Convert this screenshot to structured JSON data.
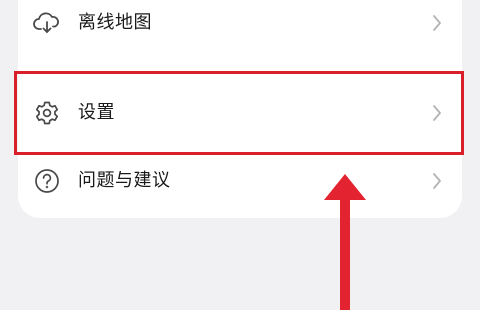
{
  "menu": {
    "items": [
      {
        "label": "离线地图",
        "icon": "cloud-download-icon"
      },
      {
        "label": "设置",
        "icon": "gear-icon"
      },
      {
        "label": "问题与建议",
        "icon": "question-circle-icon"
      }
    ]
  },
  "colors": {
    "background": "#f1f1f3",
    "card": "#ffffff",
    "highlight": "#d81f2a",
    "arrow": "#e3232f",
    "icon": "#4a4a4a",
    "chevron": "#b3b3b3"
  }
}
